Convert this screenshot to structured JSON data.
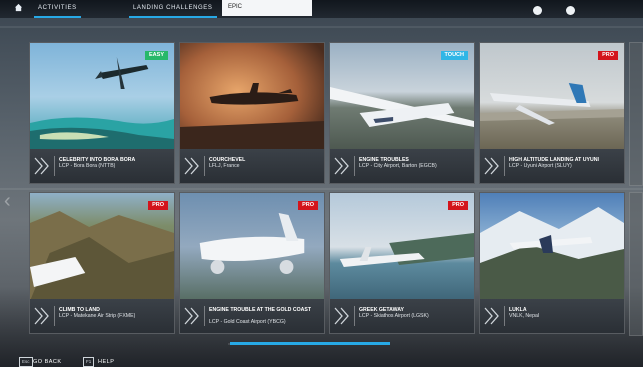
{
  "tabs": {
    "activities": "ACTIVITIES",
    "landing_challenges": "LANDING CHALLENGES",
    "epic": "EPIC"
  },
  "colors": {
    "accent": "#27a9e6",
    "easy": "#27b86a",
    "touch": "#2fb6e6",
    "pro": "#d3141b"
  },
  "cards": [
    {
      "title": "CELEBRITY INTO BORA BORA",
      "subtitle": "LCP - Bora Bora (NTTB)",
      "badge": "EASY",
      "badge_color": "#27b86a"
    },
    {
      "title": "COURCHEVEL",
      "subtitle": "LFLJ, France",
      "badge": "",
      "badge_color": ""
    },
    {
      "title": "ENGINE TROUBLES",
      "subtitle": "LCP - City Airport, Barton (EGCB)",
      "badge": "TOUCH",
      "badge_color": "#2fb6e6"
    },
    {
      "title": "HIGH ALTITUDE LANDING AT UYUNI",
      "subtitle": "LCP - Uyuni Airport (SLUY)",
      "badge": "PRO",
      "badge_color": "#d3141b"
    },
    {
      "title": "CLIMB TO LAND",
      "subtitle": "LCP - Matekane Air Strip (FXME)",
      "badge": "PRO",
      "badge_color": "#d3141b"
    },
    {
      "title": "ENGINE TROUBLE AT THE GOLD COAST",
      "subtitle": "LCP - Gold Coast Airport (YBCG)",
      "badge": "PRO",
      "badge_color": "#d3141b"
    },
    {
      "title": "GREEK GETAWAY",
      "subtitle": "LCP - Skiathos Airport (LGSK)",
      "badge": "PRO",
      "badge_color": "#d3141b"
    },
    {
      "title": "LUKLA",
      "subtitle": "VNLK, Nepal",
      "badge": "",
      "badge_color": ""
    }
  ],
  "footer": {
    "back_key": "Esc",
    "back_label": "GO BACK",
    "help_key": "F1",
    "help_label": "HELP"
  }
}
